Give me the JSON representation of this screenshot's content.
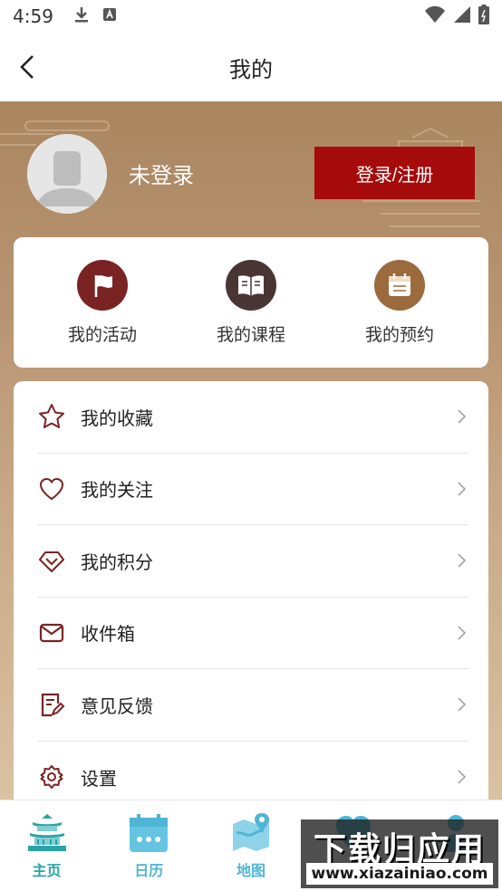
{
  "status_bar": {
    "time": "4:59",
    "icons": [
      "download-icon",
      "app-notification-icon",
      "wifi-icon",
      "signal-icon",
      "battery-icon"
    ]
  },
  "header": {
    "title": "我的",
    "back_icon": "chevron-left-icon"
  },
  "profile": {
    "login_status": "未登录",
    "login_button": "登录/注册"
  },
  "quick_actions": [
    {
      "label": "我的活动",
      "icon": "flag-icon",
      "color": "#7a2323"
    },
    {
      "label": "我的课程",
      "icon": "book-icon",
      "color": "#4a3535"
    },
    {
      "label": "我的预约",
      "icon": "calendar-icon",
      "color": "#9b6b3e"
    }
  ],
  "menu": [
    {
      "label": "我的收藏",
      "icon": "star-icon"
    },
    {
      "label": "我的关注",
      "icon": "heart-icon"
    },
    {
      "label": "我的积分",
      "icon": "diamond-icon"
    },
    {
      "label": "收件箱",
      "icon": "mail-icon"
    },
    {
      "label": "意见反馈",
      "icon": "feedback-icon"
    },
    {
      "label": "设置",
      "icon": "gear-icon"
    }
  ],
  "tabs": [
    {
      "label": "主页",
      "icon": "pagoda-icon"
    },
    {
      "label": "日历",
      "icon": "calendar-icon"
    },
    {
      "label": "地图",
      "icon": "map-icon"
    },
    {
      "label": "",
      "icon": "heart-icon"
    },
    {
      "label": "",
      "icon": "user-icon"
    }
  ],
  "watermark": {
    "title": "下载归应用",
    "url": "www.xiazainiao.com"
  },
  "colors": {
    "accent": "#a50b0b",
    "tab_active": "#2aa3a8",
    "tab_inactive": "#4fb5d6",
    "icon_maroon": "#7a2323"
  }
}
